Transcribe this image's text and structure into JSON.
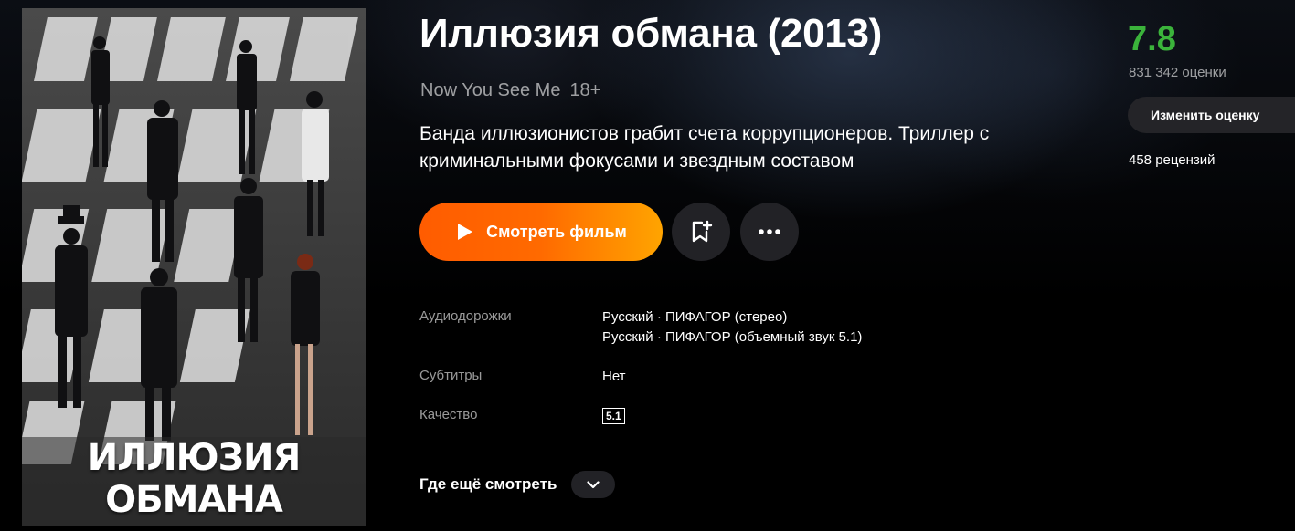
{
  "poster": {
    "title_art": "ИЛЛЮЗИЯ ОБМАНА",
    "background_letters": "ИЛЛЮЗИЯ ОБМАНА"
  },
  "film": {
    "title": "Иллюзия обмана (2013)",
    "original_title": "Now You See Me",
    "age_rating": "18+",
    "description": "Банда иллюзионистов грабит счета коррупционеров. Триллер с криминальными фокусами и звездным составом"
  },
  "actions": {
    "watch_label": "Смотреть фильм",
    "watch_icon": "play-icon",
    "bookmark_icon": "bookmark-add-icon",
    "more_icon": "more-dots-icon",
    "colors": {
      "watch_start": "#ff5c00",
      "watch_end": "#ffa400",
      "round_bg": "#222226"
    }
  },
  "details": {
    "audio_label": "Аудиодорожки",
    "audio_tracks": [
      "Русский · ПИФАГОР (стерео)",
      "Русский · ПИФАГОР (объемный звук 5.1)"
    ],
    "subtitles_label": "Субтитры",
    "subtitles_value": "Нет",
    "quality_label": "Качество",
    "quality_badge": "5.1"
  },
  "where_else": {
    "label": "Где ещё смотреть",
    "icon": "chevron-down-icon"
  },
  "rating": {
    "value": "7.8",
    "count": "831 342 оценки",
    "change_label": "Изменить оценку",
    "reviews": "458 рецензий",
    "color": "#3bb33b"
  }
}
